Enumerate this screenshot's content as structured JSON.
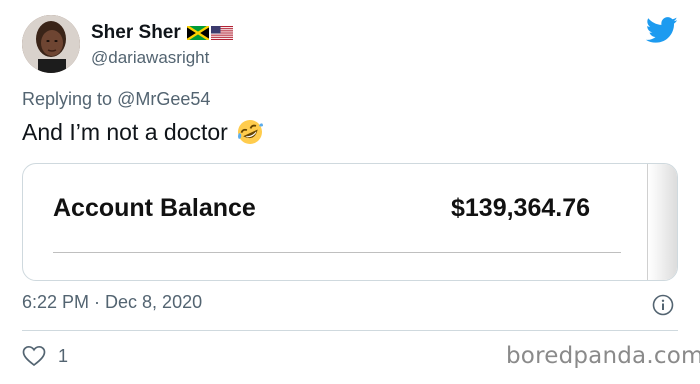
{
  "user": {
    "display_name": "Sher Sher",
    "handle": "@dariawasright",
    "flags": [
      "jamaica-flag-icon",
      "us-flag-icon"
    ]
  },
  "tweet": {
    "reply_prefix": "Replying to",
    "reply_to": "@MrGee54",
    "text": "And I’m not a doctor",
    "emoji": "rolling-on-floor-laughing-icon",
    "timestamp": "6:22 PM · Dec 8, 2020",
    "likes": "1"
  },
  "media": {
    "label": "Account Balance",
    "value": "$139,364.76"
  },
  "watermark": "boredpanda.com",
  "colors": {
    "twitter_blue": "#1d9bf0",
    "secondary_text": "#536471",
    "border": "#cfd9de"
  }
}
